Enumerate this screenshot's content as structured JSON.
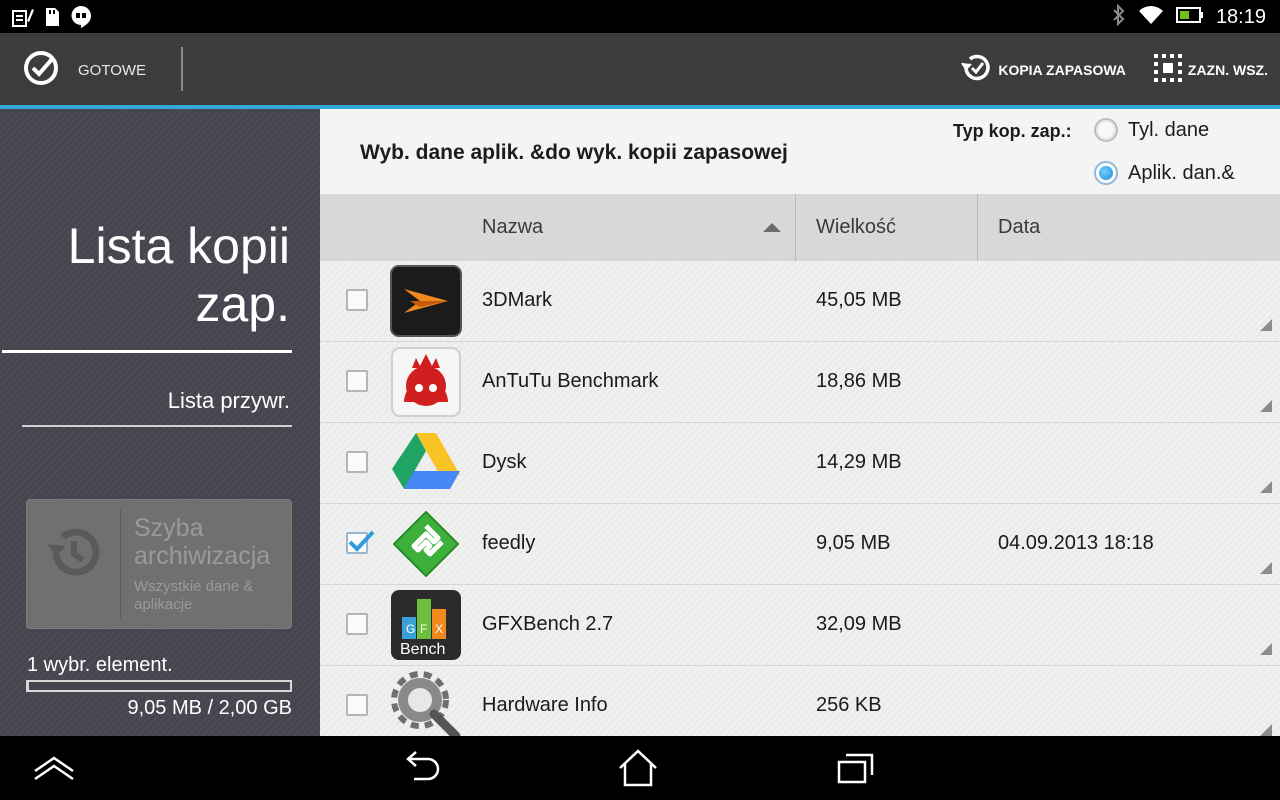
{
  "status_bar": {
    "time": "18:19",
    "left_icons": [
      "notes-icon",
      "sd-card-icon",
      "hangouts-icon"
    ],
    "right_icons": [
      "bluetooth-icon",
      "wifi-icon",
      "battery-icon"
    ]
  },
  "action_bar": {
    "done_label": "GOTOWE",
    "backup_label": "KOPIA ZAPASOWA",
    "select_all_label": "ZAZN. WSZ.",
    "accent_color": "#33a9d9"
  },
  "sidebar": {
    "title_line1": "Lista kopii",
    "title_line2": "zap.",
    "restore_list": "Lista przywr.",
    "quick_backup": {
      "title": "Szyba archiwizacja",
      "subtitle": "Wszystkie dane & aplikacje"
    },
    "selected_count": "1 wybr. element.",
    "size_summary": "9,05 MB / 2,00 GB",
    "storage_used_fraction": 0.004
  },
  "main": {
    "header_title": "Wyb. dane aplik. &do wyk. kopii zapasowej",
    "backup_type_label": "Typ kop. zap.:",
    "radio_options": [
      {
        "label": "Tyl. dane",
        "selected": false
      },
      {
        "label": "Aplik. dan.&",
        "selected": true
      }
    ],
    "columns": {
      "name": "Nazwa",
      "size": "Wielkość",
      "date": "Data"
    },
    "rows": [
      {
        "name": "3DMark",
        "size": "45,05 MB",
        "date": "",
        "checked": false,
        "icon": "3dmark-icon"
      },
      {
        "name": "AnTuTu Benchmark",
        "size": "18,86 MB",
        "date": "",
        "checked": false,
        "icon": "antutu-icon"
      },
      {
        "name": "Dysk",
        "size": "14,29 MB",
        "date": "",
        "checked": false,
        "icon": "google-drive-icon"
      },
      {
        "name": "feedly",
        "size": "9,05 MB",
        "date": "04.09.2013 18:18",
        "checked": true,
        "icon": "feedly-icon"
      },
      {
        "name": "GFXBench 2.7",
        "size": "32,09 MB",
        "date": "",
        "checked": false,
        "icon": "gfxbench-icon"
      },
      {
        "name": "Hardware Info",
        "size": "256 KB",
        "date": "",
        "checked": false,
        "icon": "hardware-info-icon"
      }
    ]
  },
  "nav_bar": {
    "buttons": [
      "menu-up-icon",
      "back-icon",
      "home-icon",
      "recent-apps-icon"
    ]
  }
}
